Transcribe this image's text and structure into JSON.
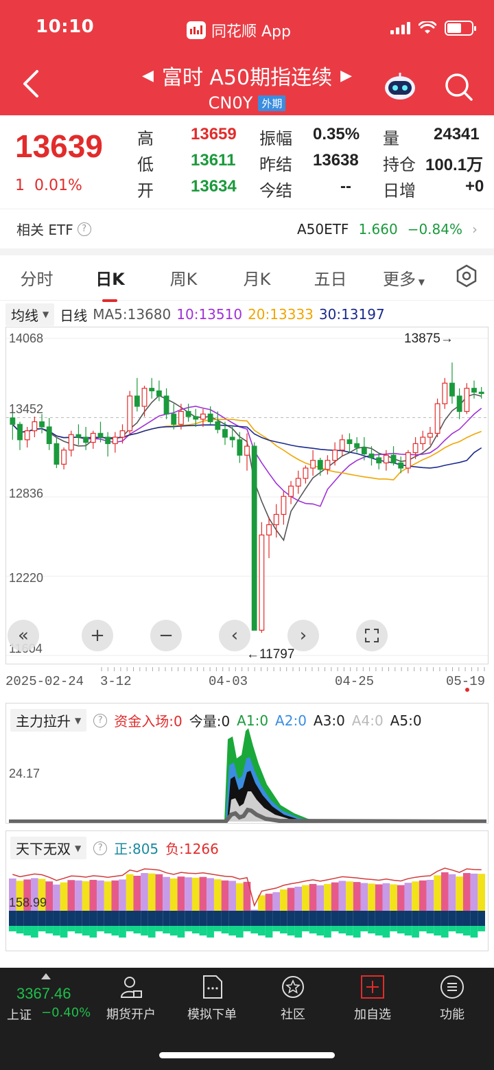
{
  "status_bar": {
    "time": "10:10",
    "app_name": "同花顺 App"
  },
  "header": {
    "title": "富时 A50期指连续",
    "code": "CN0Y",
    "tag": "外期"
  },
  "quote": {
    "price": "13639",
    "change": "1",
    "change_pct": "0.01%",
    "high_label": "高",
    "high": "13659",
    "low_label": "低",
    "low": "13611",
    "open_label": "开",
    "open": "13634",
    "amp_label": "振幅",
    "amp": "0.35%",
    "prev_settle_label": "昨结",
    "prev_settle": "13638",
    "settle_label": "今结",
    "settle": "--",
    "vol_label": "量",
    "vol": "24341",
    "oi_label": "持仓",
    "oi": "100.1万",
    "oi_chg_label": "日增",
    "oi_chg": "+0"
  },
  "etf": {
    "label": "相关 ETF",
    "name": "A50ETF",
    "price": "1.660",
    "pct": "−0.84%"
  },
  "tabs": [
    "分时",
    "日K",
    "周K",
    "月K",
    "五日",
    "更多"
  ],
  "active_tab": "日K",
  "ma_legend": {
    "selector": "均线",
    "period": "日线",
    "ma5": "MA5:13680",
    "ma10": "10:13510",
    "ma20": "20:13333",
    "ma30": "30:13197"
  },
  "colors": {
    "header_red": "#ea3b44",
    "up": "#e22b2b",
    "down": "#1a9a3c",
    "ma5": "#555555",
    "ma10": "#a030d8",
    "ma20": "#f0a500",
    "ma30": "#1a2a8a"
  },
  "chart": {
    "y_labels": [
      "14068",
      "13452",
      "12836",
      "12220",
      "11604"
    ],
    "max_marker": "13875→",
    "min_marker": "←11797",
    "x_labels": [
      "2025-02-24",
      "3-12",
      "04-03",
      "04-25",
      "05-19"
    ]
  },
  "chart_data": {
    "type": "candlestick",
    "ylim": [
      11604,
      14068
    ],
    "y_ticks": [
      14068,
      13452,
      12836,
      12220,
      11604
    ],
    "x_ticks": [
      "2025-02-24",
      "3-12",
      "04-03",
      "04-25",
      "05-19"
    ],
    "candles": [
      [
        13450,
        13500,
        13280,
        13400
      ],
      [
        13400,
        13420,
        13200,
        13280
      ],
      [
        13280,
        13380,
        13220,
        13350
      ],
      [
        13350,
        13460,
        13300,
        13420
      ],
      [
        13420,
        13480,
        13330,
        13380
      ],
      [
        13380,
        13450,
        13200,
        13250
      ],
      [
        13250,
        13300,
        13060,
        13090
      ],
      [
        13090,
        13220,
        13050,
        13200
      ],
      [
        13200,
        13350,
        13150,
        13320
      ],
      [
        13320,
        13400,
        13240,
        13300
      ],
      [
        13300,
        13380,
        13200,
        13260
      ],
      [
        13260,
        13350,
        13210,
        13330
      ],
      [
        13330,
        13420,
        13260,
        13300
      ],
      [
        13300,
        13340,
        13150,
        13250
      ],
      [
        13250,
        13340,
        13180,
        13300
      ],
      [
        13300,
        13400,
        13250,
        13350
      ],
      [
        13350,
        13660,
        13320,
        13620
      ],
      [
        13620,
        13760,
        13500,
        13540
      ],
      [
        13540,
        13700,
        13460,
        13680
      ],
      [
        13680,
        13760,
        13600,
        13660
      ],
      [
        13660,
        13740,
        13580,
        13620
      ],
      [
        13620,
        13680,
        13440,
        13480
      ],
      [
        13480,
        13560,
        13360,
        13400
      ],
      [
        13400,
        13560,
        13360,
        13500
      ],
      [
        13500,
        13560,
        13420,
        13460
      ],
      [
        13460,
        13520,
        13380,
        13440
      ],
      [
        13440,
        13520,
        13380,
        13480
      ],
      [
        13480,
        13540,
        13400,
        13420
      ],
      [
        13420,
        13500,
        13330,
        13360
      ],
      [
        13360,
        13420,
        13240,
        13300
      ],
      [
        13300,
        13380,
        13220,
        13280
      ],
      [
        13280,
        13340,
        13100,
        13160
      ],
      [
        13160,
        13330,
        13040,
        13230
      ],
      [
        13230,
        13260,
        11900,
        11800
      ],
      [
        11800,
        12640,
        11780,
        12540
      ],
      [
        12540,
        12680,
        12360,
        12620
      ],
      [
        12620,
        12780,
        12520,
        12700
      ],
      [
        12700,
        12880,
        12620,
        12840
      ],
      [
        12840,
        12960,
        12780,
        12920
      ],
      [
        12920,
        13040,
        12860,
        12980
      ],
      [
        12980,
        13080,
        12940,
        13060
      ],
      [
        13060,
        13200,
        13000,
        13120
      ],
      [
        13120,
        13140,
        13000,
        13050
      ],
      [
        13050,
        13160,
        13010,
        13120
      ],
      [
        13120,
        13260,
        13080,
        13200
      ],
      [
        13200,
        13320,
        13150,
        13280
      ],
      [
        13280,
        13330,
        13180,
        13250
      ],
      [
        13250,
        13300,
        13180,
        13220
      ],
      [
        13220,
        13300,
        13120,
        13170
      ],
      [
        13170,
        13230,
        13080,
        13140
      ],
      [
        13140,
        13180,
        13050,
        13100
      ],
      [
        13100,
        13200,
        13040,
        13160
      ],
      [
        13160,
        13230,
        13080,
        13100
      ],
      [
        13100,
        13150,
        13020,
        13060
      ],
      [
        13060,
        13200,
        13020,
        13180
      ],
      [
        13180,
        13300,
        13130,
        13250
      ],
      [
        13250,
        13350,
        13200,
        13300
      ],
      [
        13300,
        13380,
        13240,
        13330
      ],
      [
        13330,
        13600,
        13300,
        13560
      ],
      [
        13560,
        13760,
        13520,
        13720
      ],
      [
        13720,
        13880,
        13560,
        13620
      ],
      [
        13620,
        13680,
        13440,
        13500
      ],
      [
        13500,
        13720,
        13480,
        13680
      ],
      [
        13680,
        13740,
        13600,
        13650
      ],
      [
        13650,
        13690,
        13600,
        13639
      ]
    ],
    "ma_series": [
      {
        "name": "MA5",
        "value": 13680
      },
      {
        "name": "10",
        "value": 13510
      },
      {
        "name": "20",
        "value": 13333
      },
      {
        "name": "30",
        "value": 13197
      }
    ]
  },
  "sub1": {
    "selector": "主力拉升",
    "items": [
      "资金入场:0",
      "今量:0",
      "A1:0",
      "A2:0",
      "A3:0",
      "A4:0",
      "A5:0"
    ],
    "y_label": "24.17"
  },
  "sub2": {
    "selector": "天下无双",
    "pos": "正:805",
    "neg": "负:1266",
    "y_label": "158.99"
  },
  "bottom_nav": {
    "index_value": "3367.46",
    "index_name": "上证",
    "index_pct": "−0.40%",
    "items": [
      "期货开户",
      "模拟下单",
      "社区",
      "加自选",
      "功能"
    ]
  }
}
